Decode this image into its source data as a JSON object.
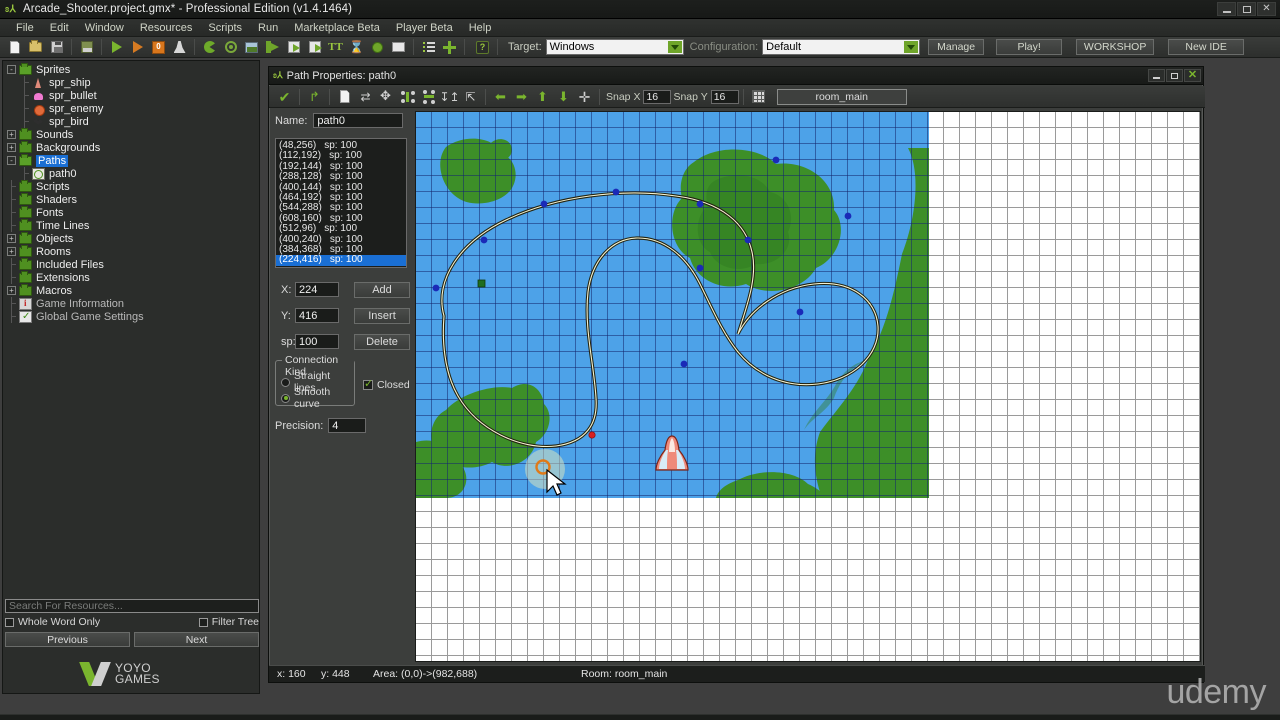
{
  "window": {
    "title": "Arcade_Shooter.project.gmx*  -  Professional Edition (v1.4.1464)",
    "icon": "gm-logo-icon",
    "minimize": "–",
    "maximize": "□",
    "close": "✕"
  },
  "menu": {
    "items": [
      "File",
      "Edit",
      "Window",
      "Resources",
      "Scripts",
      "Run",
      "Marketplace Beta",
      "Player Beta",
      "Help"
    ]
  },
  "toolbar": {
    "icons": [
      "new-icon",
      "open-icon",
      "save-icon",
      "save-all-icon",
      "run-icon",
      "run-debug-icon",
      "debug-icon",
      "clean-icon",
      "sprite-icon",
      "sound-icon",
      "background-icon",
      "path-icon",
      "script-icon",
      "shader-icon",
      "font-icon",
      "timeline-icon",
      "object-icon",
      "room-icon",
      "resource-tree-icon",
      "add-resource-icon"
    ],
    "help_icon": "help-icon",
    "target_label": "Target:",
    "target_value": "Windows",
    "config_label": "Configuration:",
    "config_value": "Default",
    "manage_label": "Manage",
    "play_label": "Play!",
    "workshop_label": "WORKSHOP",
    "newide_label": "New IDE"
  },
  "resource_tree": {
    "items": [
      {
        "label": "Sprites",
        "level": 0,
        "expander": "-",
        "kind": "folder-open",
        "selected": false
      },
      {
        "label": "spr_ship",
        "level": 1,
        "expander": "",
        "kind": "sprite-ship",
        "selected": false
      },
      {
        "label": "spr_bullet",
        "level": 1,
        "expander": "",
        "kind": "sprite-bullet",
        "selected": false
      },
      {
        "label": "spr_enemy",
        "level": 1,
        "expander": "",
        "kind": "sprite-enemy",
        "selected": false
      },
      {
        "label": "spr_bird",
        "level": 1,
        "expander": "",
        "kind": "sprite-bird",
        "selected": false
      },
      {
        "label": "Sounds",
        "level": 0,
        "expander": "+",
        "kind": "folder",
        "selected": false
      },
      {
        "label": "Backgrounds",
        "level": 0,
        "expander": "+",
        "kind": "folder",
        "selected": false
      },
      {
        "label": "Paths",
        "level": 0,
        "expander": "-",
        "kind": "folder-open",
        "selected": true
      },
      {
        "label": "path0",
        "level": 1,
        "expander": "",
        "kind": "path",
        "selected": false
      },
      {
        "label": "Scripts",
        "level": 0,
        "expander": "",
        "kind": "folder",
        "selected": false
      },
      {
        "label": "Shaders",
        "level": 0,
        "expander": "",
        "kind": "folder",
        "selected": false
      },
      {
        "label": "Fonts",
        "level": 0,
        "expander": "",
        "kind": "folder",
        "selected": false
      },
      {
        "label": "Time Lines",
        "level": 0,
        "expander": "",
        "kind": "folder",
        "selected": false
      },
      {
        "label": "Objects",
        "level": 0,
        "expander": "+",
        "kind": "folder",
        "selected": false
      },
      {
        "label": "Rooms",
        "level": 0,
        "expander": "+",
        "kind": "folder",
        "selected": false
      },
      {
        "label": "Included Files",
        "level": 0,
        "expander": "",
        "kind": "folder",
        "selected": false
      },
      {
        "label": "Extensions",
        "level": 0,
        "expander": "",
        "kind": "folder",
        "selected": false
      },
      {
        "label": "Macros",
        "level": 0,
        "expander": "+",
        "kind": "folder",
        "selected": false
      },
      {
        "label": "Game Information",
        "level": 0,
        "expander": "",
        "kind": "info",
        "selected": false
      },
      {
        "label": "Global Game Settings",
        "level": 0,
        "expander": "",
        "kind": "settings",
        "selected": false
      }
    ]
  },
  "search": {
    "placeholder": "Search For Resources...",
    "value": "",
    "whole_word_label": "Whole Word Only",
    "whole_word_checked": false,
    "filter_tree_label": "Filter Tree",
    "filter_tree_checked": false,
    "previous_label": "Previous",
    "next_label": "Next"
  },
  "branding": {
    "line1": "YOYO",
    "line2": "GAMES",
    "watermark": "udemy"
  },
  "path_window": {
    "title": "Path Properties: path0",
    "minimize": "–",
    "maximize": "□",
    "close": "✕",
    "toolbar": {
      "ok_icon": "checkmark-icon",
      "undo_icon": "undo-icon",
      "clear_icon": "clear-points-icon",
      "reverse_icon": "reverse-path-icon",
      "shift_icon": "shift-path-icon",
      "mirror_icon": "mirror-horizontal-icon",
      "flip_icon": "flip-vertical-icon",
      "rotate_icon": "rotate-icon",
      "scale_icon": "scale-icon",
      "left_icon": "move-left-icon",
      "right_icon": "move-right-icon",
      "up_icon": "move-up-icon",
      "down_icon": "move-down-icon",
      "center_icon": "center-icon",
      "grid_icon": "toggle-grid-icon",
      "snapx_label": "Snap X",
      "snapx_value": "16",
      "snapy_label": "Snap Y",
      "snapy_value": "16",
      "room_button": "room_main"
    },
    "name_label": "Name:",
    "name_value": "path0",
    "points": [
      {
        "coords": "(48,256)",
        "sp": "sp: 100",
        "selected": false
      },
      {
        "coords": "(112,192)",
        "sp": "sp: 100",
        "selected": false
      },
      {
        "coords": "(192,144)",
        "sp": "sp: 100",
        "selected": false
      },
      {
        "coords": "(288,128)",
        "sp": "sp: 100",
        "selected": false
      },
      {
        "coords": "(400,144)",
        "sp": "sp: 100",
        "selected": false
      },
      {
        "coords": "(464,192)",
        "sp": "sp: 100",
        "selected": false
      },
      {
        "coords": "(544,288)",
        "sp": "sp: 100",
        "selected": false
      },
      {
        "coords": "(608,160)",
        "sp": "sp: 100",
        "selected": false
      },
      {
        "coords": "(512,96)",
        "sp": "sp: 100",
        "selected": false
      },
      {
        "coords": "(400,240)",
        "sp": "sp: 100",
        "selected": false
      },
      {
        "coords": "(384,368)",
        "sp": "sp: 100",
        "selected": false
      },
      {
        "coords": "(224,416)",
        "sp": "sp: 100",
        "selected": true
      }
    ],
    "x_label": "X:",
    "x_value": "224",
    "y_label": "Y:",
    "y_value": "416",
    "sp_label": "sp:",
    "sp_value": "100",
    "add_label": "Add",
    "insert_label": "Insert",
    "delete_label": "Delete",
    "connection_kind_label": "Connection Kind",
    "straight_lines_label": "Straight lines",
    "smooth_curve_label": "Smooth curve",
    "connection_selected": "smooth",
    "closed_label": "Closed",
    "closed_checked": true,
    "precision_label": "Precision:",
    "precision_value": "4",
    "status": {
      "x": "x: 160",
      "y": "y: 448",
      "area": "Area: (0,0)->(982,688)",
      "room": "Room: room_main"
    }
  },
  "colors": {
    "water": "#4da2e8",
    "land": "#3d8f28",
    "land_dark": "#2f7a1e",
    "path_stroke": "#f2f0c8",
    "path_outline": "#2a2a10",
    "point": "#1a2ab8",
    "point_selected": "#1f7a1f",
    "point_red": "#d82020",
    "accent_green": "#7ab52e",
    "select_blue": "#1a6fd4",
    "chrome": "#3c3e3c"
  },
  "canvas": {
    "room_width": 513,
    "room_height": 386,
    "grid_size": 16,
    "ship_sprite": "ship-sprite",
    "cursor": "mouse-cursor"
  }
}
